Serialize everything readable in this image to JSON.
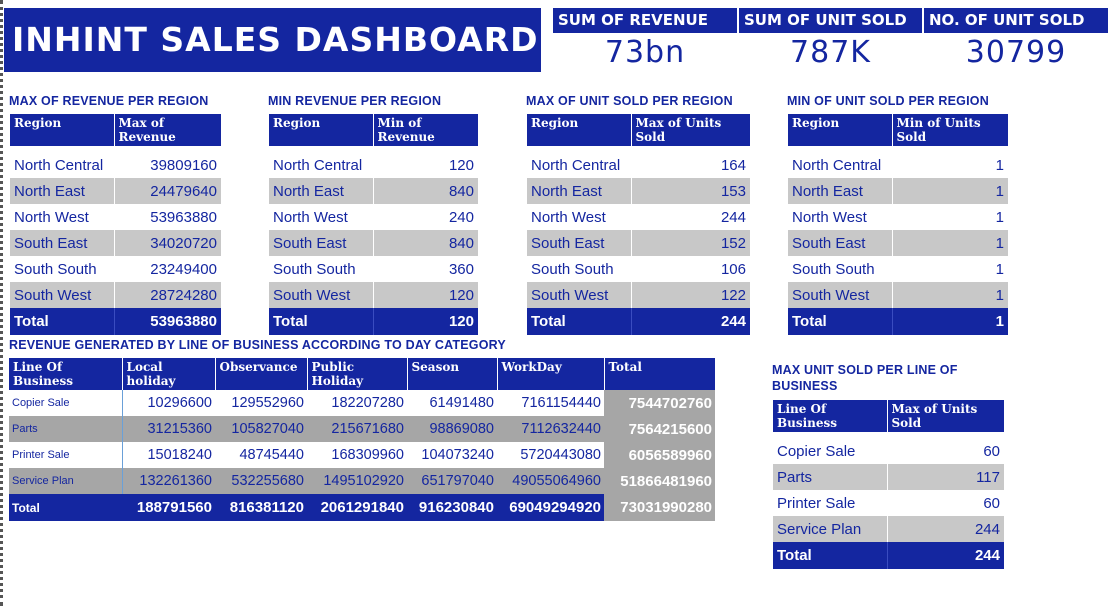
{
  "dashboard": {
    "title": "INHINT SALES DASHBOARD"
  },
  "kpis": [
    {
      "label": "SUM OF REVENUE",
      "value": "73bn"
    },
    {
      "label": "SUM OF UNIT SOLD",
      "value": "787K"
    },
    {
      "label": "NO. OF UNIT SOLD",
      "value": "30799"
    }
  ],
  "region_tables": [
    {
      "title": "MAX OF REVENUE PER REGION",
      "headers": [
        "Region",
        "Max of Revenue"
      ],
      "rows": [
        [
          "North Central",
          "39809160"
        ],
        [
          "North East",
          "24479640"
        ],
        [
          "North West",
          "53963880"
        ],
        [
          "South East",
          "34020720"
        ],
        [
          "South South",
          "23249400"
        ],
        [
          "South West",
          "28724280"
        ]
      ],
      "total": [
        "Total",
        "53963880"
      ]
    },
    {
      "title": "MIN REVENUE PER REGION",
      "headers": [
        "Region",
        "Min of Revenue"
      ],
      "rows": [
        [
          "North Central",
          "120"
        ],
        [
          "North East",
          "840"
        ],
        [
          "North West",
          "240"
        ],
        [
          "South East",
          "840"
        ],
        [
          "South South",
          "360"
        ],
        [
          "South West",
          "120"
        ]
      ],
      "total": [
        "Total",
        "120"
      ]
    },
    {
      "title": "MAX OF UNIT SOLD PER REGION",
      "headers": [
        "Region",
        "Max of Units Sold"
      ],
      "rows": [
        [
          "North Central",
          "164"
        ],
        [
          "North East",
          "153"
        ],
        [
          "North West",
          "244"
        ],
        [
          "South East",
          "152"
        ],
        [
          "South South",
          "106"
        ],
        [
          "South West",
          "122"
        ]
      ],
      "total": [
        "Total",
        "244"
      ]
    },
    {
      "title": "MIN OF UNIT SOLD PER REGION",
      "headers": [
        "Region",
        "Min of Units Sold"
      ],
      "rows": [
        [
          "North Central",
          "1"
        ],
        [
          "North East",
          "1"
        ],
        [
          "North West",
          "1"
        ],
        [
          "South East",
          "1"
        ],
        [
          "South South",
          "1"
        ],
        [
          "South West",
          "1"
        ]
      ],
      "total": [
        "Total",
        "1"
      ]
    }
  ],
  "day_category": {
    "title": "REVENUE GENERATED BY LINE OF BUSINESS ACCORDING TO DAY CATEGORY",
    "headers": [
      "Line Of Business",
      "Local holiday",
      "Observance",
      "Public Holiday",
      "Season",
      "WorkDay",
      "Total"
    ],
    "rows": [
      [
        "Copier Sale",
        "10296600",
        "129552960",
        "182207280",
        "61491480",
        "7161154440",
        "7544702760"
      ],
      [
        "Parts",
        "31215360",
        "105827040",
        "215671680",
        "98869080",
        "7112632440",
        "7564215600"
      ],
      [
        "Printer Sale",
        "15018240",
        "48745440",
        "168309960",
        "104073240",
        "5720443080",
        "6056589960"
      ],
      [
        "Service Plan",
        "132261360",
        "532255680",
        "1495102920",
        "651797040",
        "49055064960",
        "51866481960"
      ]
    ],
    "total": [
      "Total",
      "188791560",
      "816381120",
      "2061291840",
      "916230840",
      "69049294920",
      "73031990280"
    ]
  },
  "lob_units": {
    "title": "MAX UNIT SOLD PER LINE OF BUSINESS",
    "headers": [
      "Line Of Business",
      "Max of Units Sold"
    ],
    "rows": [
      [
        "Copier Sale",
        "60"
      ],
      [
        "Parts",
        "117"
      ],
      [
        "Printer Sale",
        "60"
      ],
      [
        "Service Plan",
        "244"
      ]
    ],
    "total": [
      "Total",
      "244"
    ]
  }
}
